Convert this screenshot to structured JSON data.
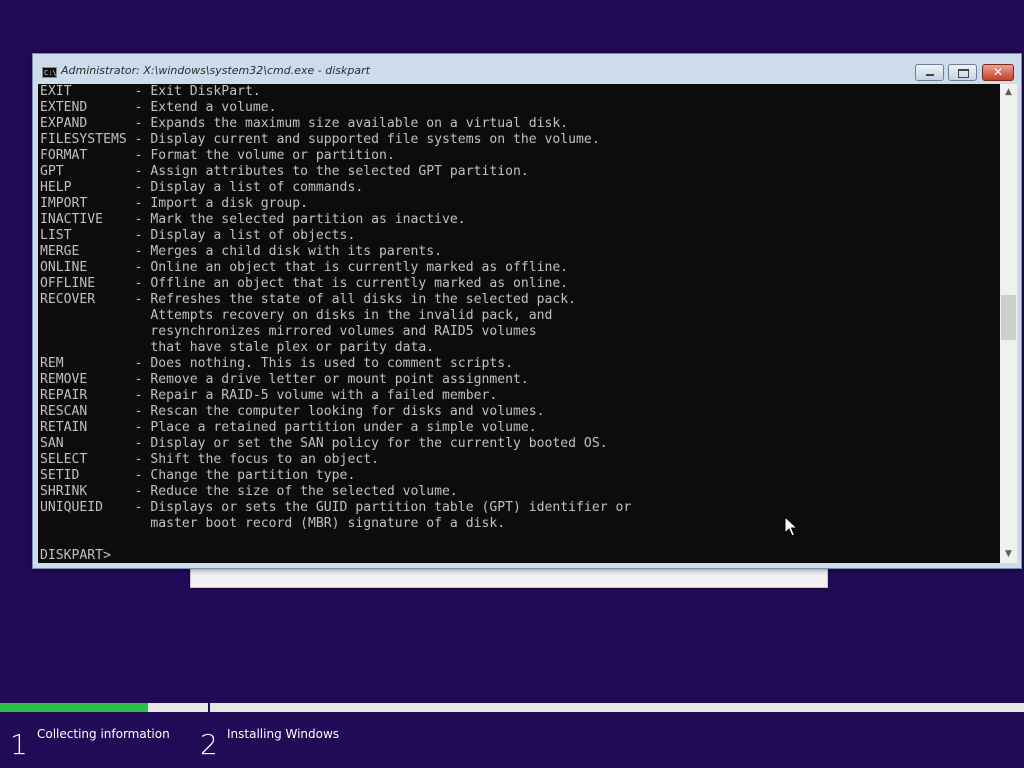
{
  "window": {
    "title": "Administrator: X:\\windows\\system32\\cmd.exe - diskpart",
    "icon": "cmd-icon",
    "icon_glyph": "C:\\",
    "minimize_label": "",
    "maximize_label": "",
    "close_glyph": "✕"
  },
  "console": {
    "lines": [
      "EXIT        - Exit DiskPart.",
      "EXTEND      - Extend a volume.",
      "EXPAND      - Expands the maximum size available on a virtual disk.",
      "FILESYSTEMS - Display current and supported file systems on the volume.",
      "FORMAT      - Format the volume or partition.",
      "GPT         - Assign attributes to the selected GPT partition.",
      "HELP        - Display a list of commands.",
      "IMPORT      - Import a disk group.",
      "INACTIVE    - Mark the selected partition as inactive.",
      "LIST        - Display a list of objects.",
      "MERGE       - Merges a child disk with its parents.",
      "ONLINE      - Online an object that is currently marked as offline.",
      "OFFLINE     - Offline an object that is currently marked as online.",
      "RECOVER     - Refreshes the state of all disks in the selected pack.",
      "              Attempts recovery on disks in the invalid pack, and",
      "              resynchronizes mirrored volumes and RAID5 volumes",
      "              that have stale plex or parity data.",
      "REM         - Does nothing. This is used to comment scripts.",
      "REMOVE      - Remove a drive letter or mount point assignment.",
      "REPAIR      - Repair a RAID-5 volume with a failed member.",
      "RESCAN      - Rescan the computer looking for disks and volumes.",
      "RETAIN      - Place a retained partition under a simple volume.",
      "SAN         - Display or set the SAN policy for the currently booted OS.",
      "SELECT      - Shift the focus to an object.",
      "SETID       - Change the partition type.",
      "SHRINK      - Reduce the size of the selected volume.",
      "UNIQUEID    - Displays or sets the GUID partition table (GPT) identifier or",
      "              master boot record (MBR) signature of a disk.",
      "",
      "DISKPART> "
    ]
  },
  "scrollbar": {
    "up_glyph": "▲",
    "down_glyph": "▼"
  },
  "setup_progress": {
    "fill_fraction": 0.145,
    "fill_color": "#2dbf4c",
    "steps": [
      {
        "number": "1",
        "label": "Collecting information"
      },
      {
        "number": "2",
        "label": "Installing Windows"
      }
    ]
  },
  "colors": {
    "desktop_background": "#230a57",
    "console_background": "#0c0c0c",
    "console_text": "#c0c0c0"
  }
}
